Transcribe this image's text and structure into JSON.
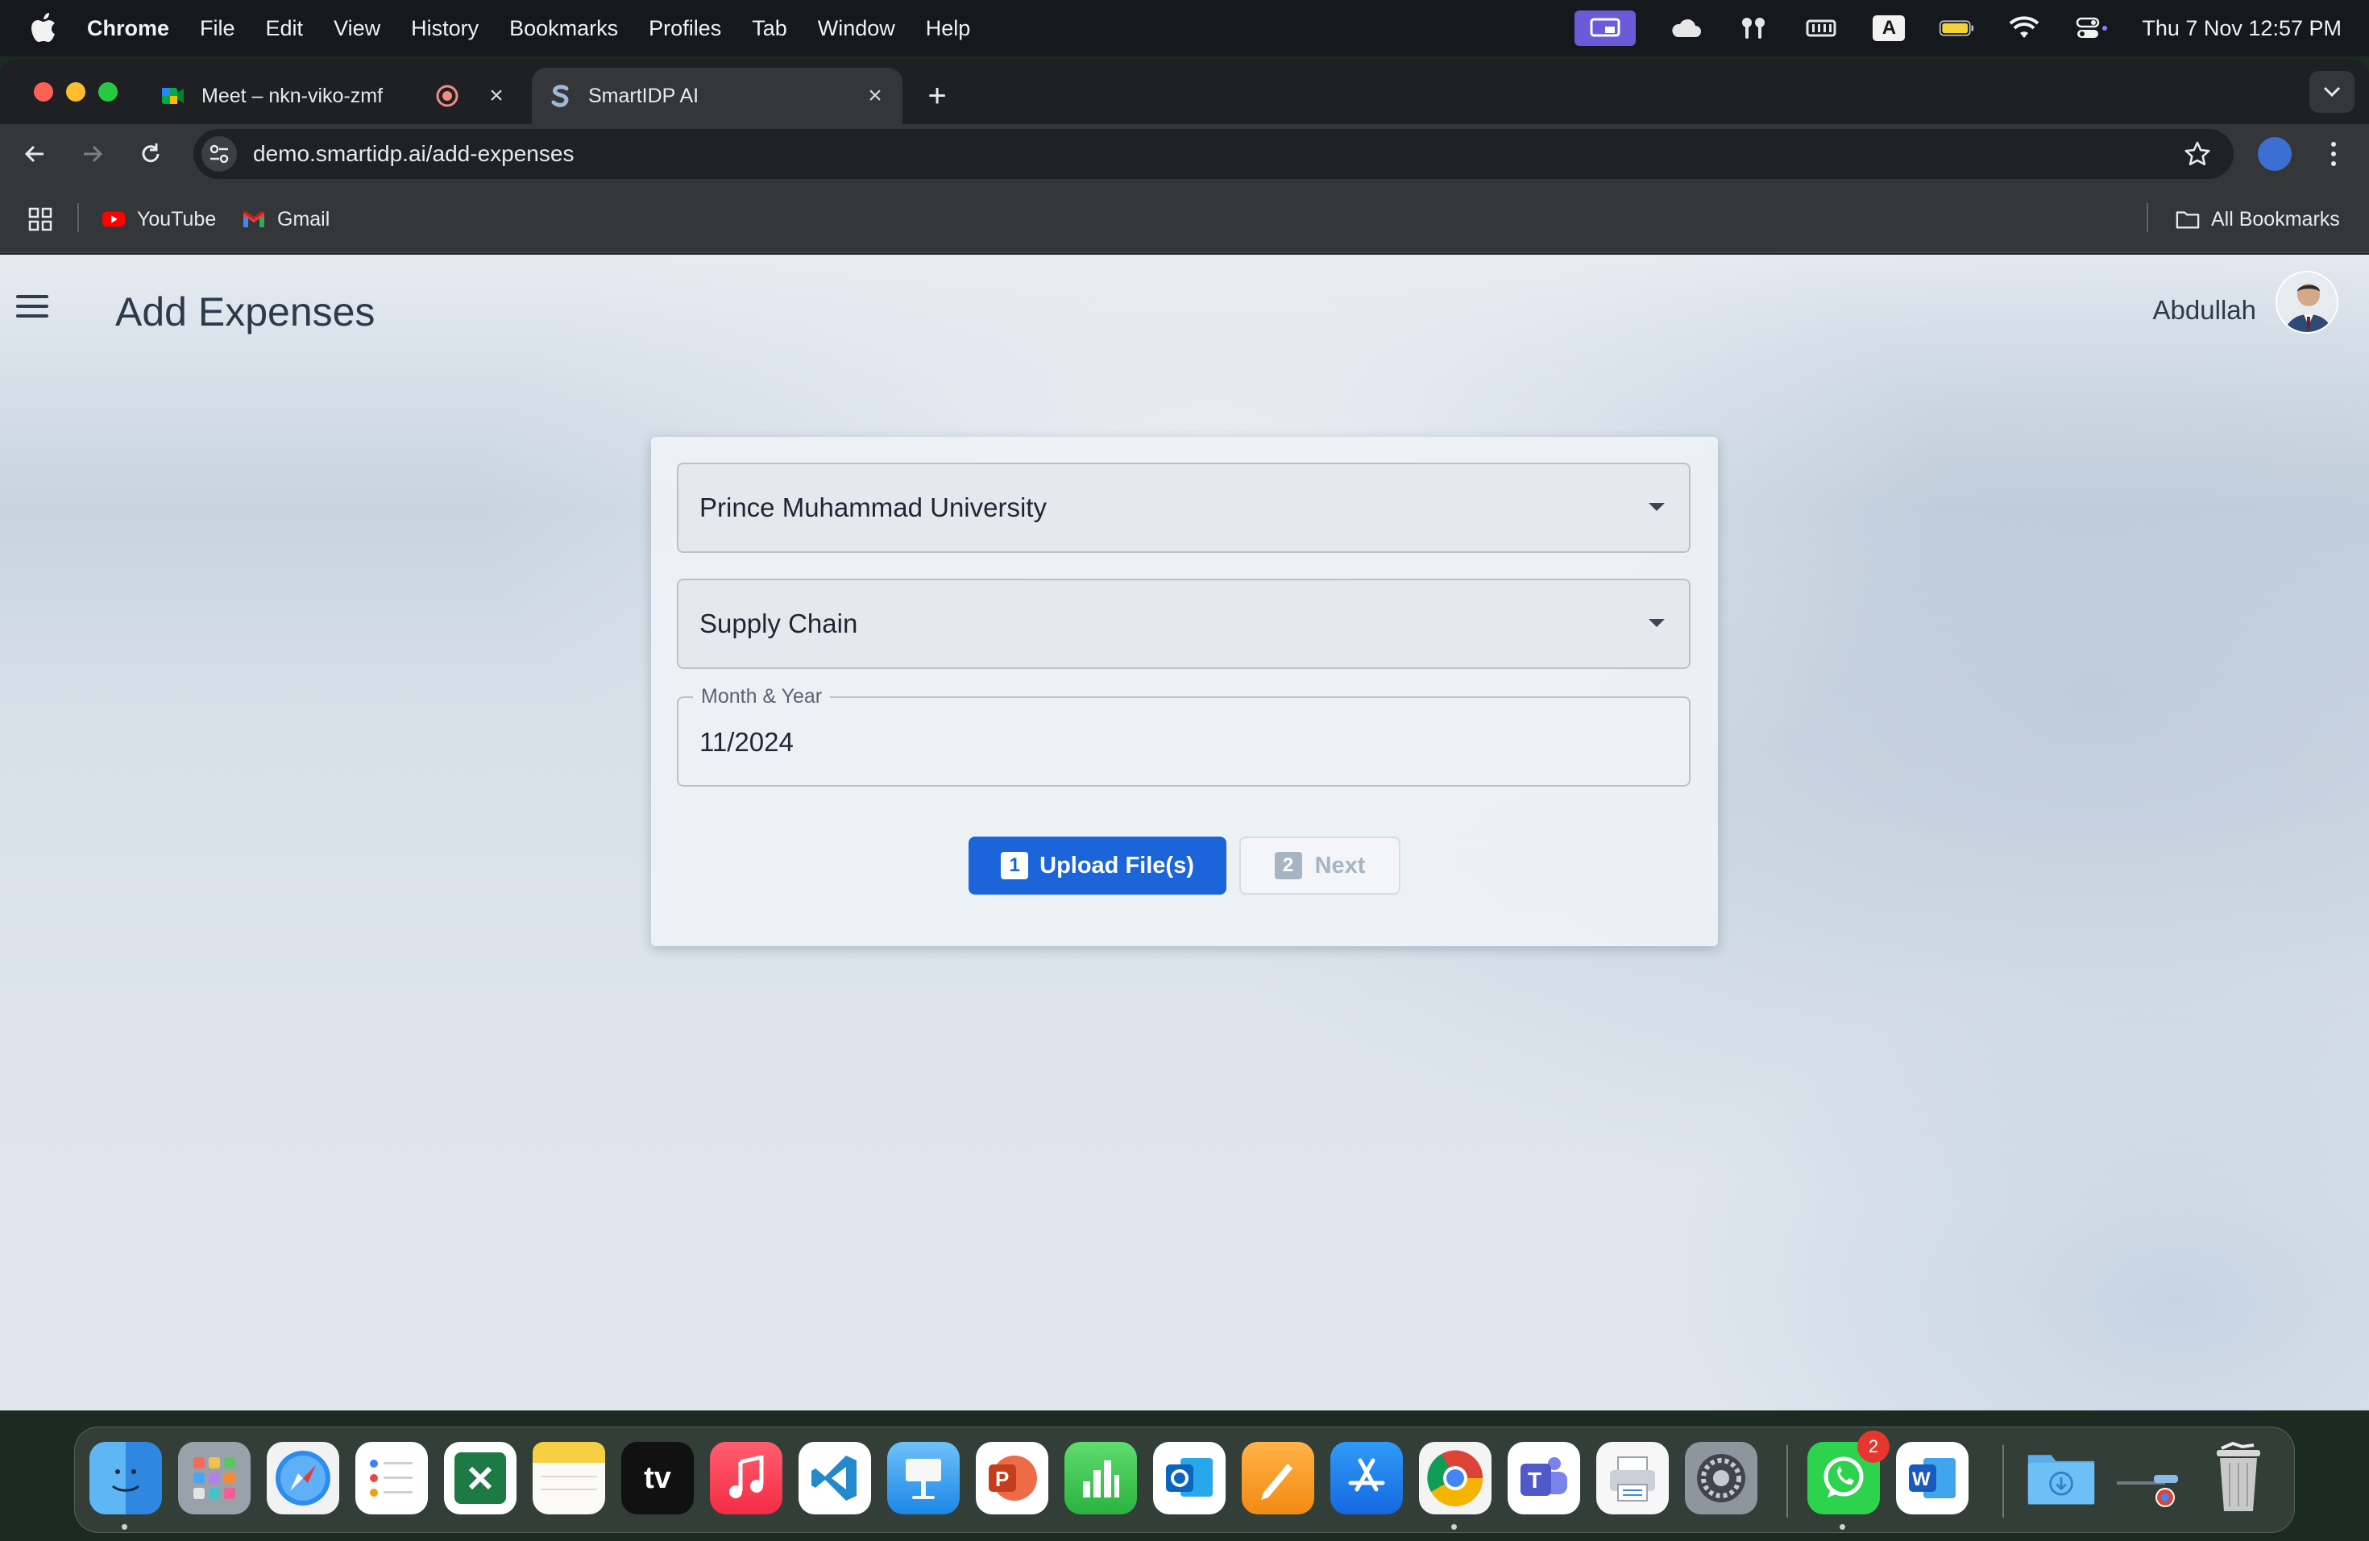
{
  "menubar": {
    "app_name": "Chrome",
    "items": [
      "File",
      "Edit",
      "View",
      "History",
      "Bookmarks",
      "Profiles",
      "Tab",
      "Window",
      "Help"
    ],
    "input_source": "A",
    "clock": "Thu 7 Nov  12:57 PM"
  },
  "browser": {
    "tabs": [
      {
        "title": "Meet – nkn-viko-zmf",
        "icon": "google-meet-icon",
        "recording": true
      },
      {
        "title": "SmartIDP AI",
        "icon": "smartidp-icon",
        "active": true
      }
    ],
    "url": "demo.smartidp.ai/add-expenses",
    "bookmarks": [
      {
        "label": "YouTube",
        "icon": "youtube-icon"
      },
      {
        "label": "Gmail",
        "icon": "gmail-icon"
      }
    ],
    "all_bookmarks_label": "All Bookmarks"
  },
  "page": {
    "title": "Add Expenses",
    "user_name": "Abdullah",
    "form": {
      "organization": "Prince Muhammad University",
      "department": "Supply Chain",
      "month_year_label": "Month & Year",
      "month_year_value": "11/2024"
    },
    "steps": [
      {
        "number": "1",
        "label": "Upload File(s)",
        "state": "active"
      },
      {
        "number": "2",
        "label": "Next",
        "state": "disabled"
      }
    ]
  },
  "dock": {
    "apps": [
      "Finder",
      "Launchpad",
      "Safari",
      "Reminders",
      "Excel",
      "Notes",
      "TV",
      "Music",
      "VS Code",
      "Keynote",
      "PowerPoint",
      "Numbers",
      "Outlook",
      "Pages",
      "App Store",
      "Chrome",
      "Teams",
      "Printer",
      "System Settings",
      "WhatsApp",
      "Word",
      "Downloads",
      "Recent",
      "Trash"
    ],
    "tv_label": "tv",
    "whatsapp_badge": "2"
  },
  "colors": {
    "primary": "#1b64da",
    "disabled": "#a7b4c3",
    "title_text": "#2d3a4a"
  }
}
